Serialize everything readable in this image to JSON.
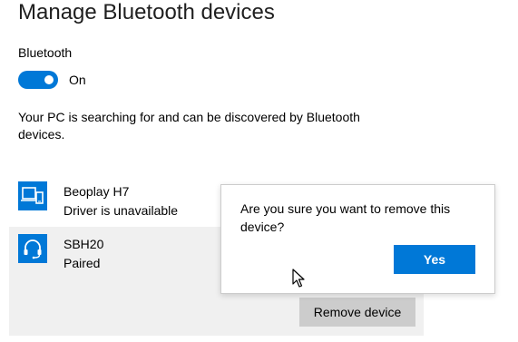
{
  "page": {
    "title": "Manage Bluetooth devices"
  },
  "bluetooth": {
    "label": "Bluetooth",
    "toggle_state": "On",
    "toggle_on": true,
    "accent_color": "#0078d7",
    "discovery_text": "Your PC is searching for and can be discovered by Bluetooth devices."
  },
  "devices": [
    {
      "icon": "phone-tablet-icon",
      "name": "Beoplay H7",
      "status": "Driver is unavailable"
    },
    {
      "icon": "headset-icon",
      "name": "SBH20",
      "status": "Paired",
      "selected": true
    }
  ],
  "remove_button_label": "Remove device",
  "confirm_flyout": {
    "message": "Are you sure you want to remove this device?",
    "yes_label": "Yes"
  },
  "cursor": {
    "icon": "mouse-pointer-icon"
  }
}
